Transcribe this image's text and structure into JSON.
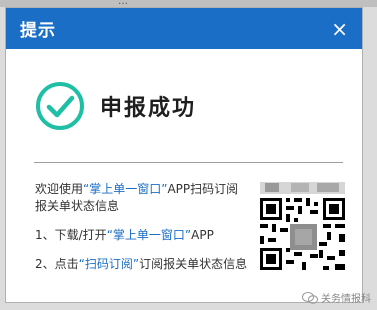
{
  "background": {
    "fragment": "…"
  },
  "dialog": {
    "title": "提示",
    "close_icon": "×",
    "status_text": "申报成功",
    "info_prefix": "欢迎使用",
    "info_link": "“掌上单一窗口”",
    "info_suffix": "APP扫码订阅报关单状态信息",
    "step1_prefix": "1、下载/打开",
    "step1_link": "“掌上单一窗口”",
    "step1_suffix": "APP",
    "step2_prefix": "2、点击",
    "step2_link": "“扫码订阅”",
    "step2_suffix": "订阅报关单状态信息"
  },
  "watermark": {
    "text": "关务情报科"
  },
  "colors": {
    "header_bg": "#1a6ec5",
    "success_teal": "#1fbfa6",
    "link_blue": "#1a6ec5"
  },
  "icons": {
    "success": "check-circle-icon",
    "close": "close-icon",
    "qr": "qr-code",
    "watermark": "wechat-icon"
  }
}
